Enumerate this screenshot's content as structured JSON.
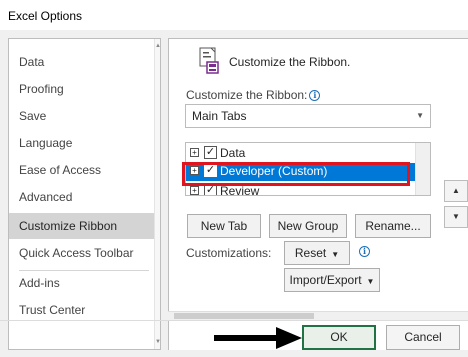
{
  "window": {
    "title": "Excel Options"
  },
  "nav": {
    "items": [
      {
        "label": "Data",
        "selected": false
      },
      {
        "label": "Proofing",
        "selected": false
      },
      {
        "label": "Save",
        "selected": false
      },
      {
        "label": "Language",
        "selected": false
      },
      {
        "label": "Ease of Access",
        "selected": false
      },
      {
        "label": "Advanced",
        "selected": false
      },
      {
        "label": "Customize Ribbon",
        "selected": true
      },
      {
        "label": "Quick Access Toolbar",
        "selected": false
      },
      {
        "label": "Add-ins",
        "selected": false
      },
      {
        "label": "Trust Center",
        "selected": false
      }
    ]
  },
  "main": {
    "heading": "Customize the Ribbon.",
    "customize_label": "Customize the Ribbon:",
    "dropdown_value": "Main Tabs",
    "tabs": [
      {
        "label": "Data",
        "checked": true,
        "selected": false
      },
      {
        "label": "Developer (Custom)",
        "checked": true,
        "selected": true
      },
      {
        "label": "Review",
        "checked": true,
        "selected": false
      }
    ],
    "buttons": {
      "new_tab": "New Tab",
      "new_group": "New Group",
      "rename": "Rename..."
    },
    "customizations_label": "Customizations:",
    "reset": "Reset",
    "import_export": "Import/Export"
  },
  "footer": {
    "ok": "OK",
    "cancel": "Cancel"
  },
  "colors": {
    "accent": "#217346",
    "selection": "#0078d7",
    "highlight": "#e0141e"
  },
  "icons": [
    "ribbon-customize-icon",
    "info-icon",
    "expand-icon",
    "checkbox-icon",
    "move-up-icon",
    "move-down-icon",
    "arrow-pointer-icon"
  ]
}
